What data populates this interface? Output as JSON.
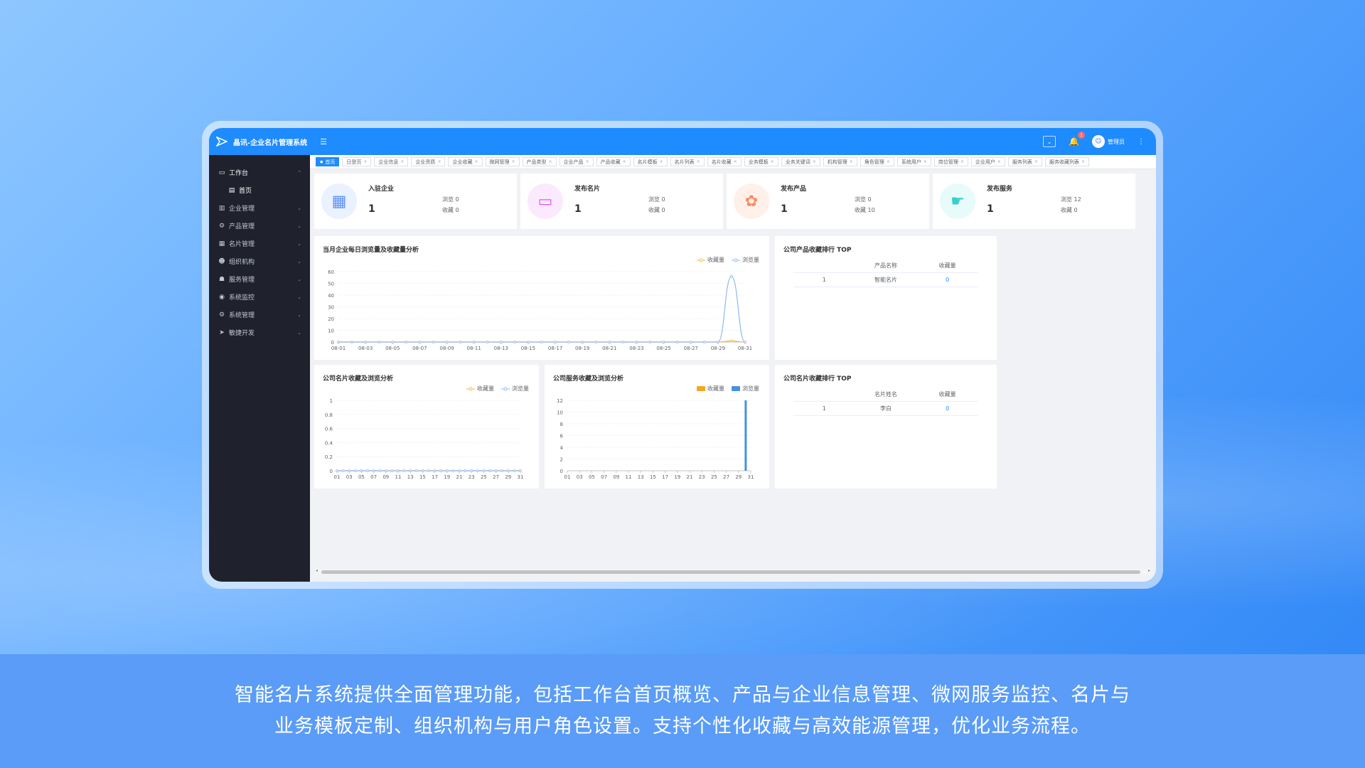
{
  "app": {
    "title": "晶讯-企业名片管理系统",
    "notification_count": "1",
    "user_name": "管理员"
  },
  "sidebar": {
    "items": [
      {
        "label": "工作台",
        "icon": "monitor-icon"
      },
      {
        "label": "首页",
        "icon": "document-icon"
      },
      {
        "label": "企业管理",
        "icon": "building-icon"
      },
      {
        "label": "产品管理",
        "icon": "gear-icon"
      },
      {
        "label": "名片管理",
        "icon": "card-icon"
      },
      {
        "label": "组织机构",
        "icon": "people-icon"
      },
      {
        "label": "服务管理",
        "icon": "service-icon"
      },
      {
        "label": "系统监控",
        "icon": "monitor-dial-icon"
      },
      {
        "label": "系统管理",
        "icon": "settings-icon"
      },
      {
        "label": "敏捷开发",
        "icon": "send-icon"
      }
    ]
  },
  "tabs": [
    "首页",
    "日登页",
    "企业信息",
    "企业资质",
    "企业收藏",
    "微网管理",
    "产品类型",
    "企业产品",
    "产品收藏",
    "名片模板",
    "名片列表",
    "名片收藏",
    "业务模板",
    "业务关键词",
    "机构管理",
    "角色管理",
    "系统用户",
    "岗位管理",
    "企业用户",
    "服务列表",
    "服务收藏列表"
  ],
  "stats": [
    {
      "title": "入驻企业",
      "value": "1",
      "browse_label": "浏览",
      "browse": "0",
      "fav_label": "收藏",
      "fav": "0",
      "color": "#5b8ff9",
      "bg": "#eaf1ff"
    },
    {
      "title": "发布名片",
      "value": "1",
      "browse_label": "浏览",
      "browse": "0",
      "fav_label": "收藏",
      "fav": "0",
      "color": "#e056fd",
      "bg": "#fbeafe"
    },
    {
      "title": "发布产品",
      "value": "1",
      "browse_label": "浏览",
      "browse": "0",
      "fav_label": "收藏",
      "fav": "10",
      "color": "#ff8a5c",
      "bg": "#fff0ea"
    },
    {
      "title": "发布服务",
      "value": "1",
      "browse_label": "浏览",
      "browse": "12",
      "fav_label": "收藏",
      "fav": "0",
      "color": "#36cfc9",
      "bg": "#e6fbfa"
    }
  ],
  "panels": {
    "daily": {
      "title": "当月企业每日浏览量及收藏量分析"
    },
    "product_top": {
      "title": "公司产品收藏排行 TOP",
      "col1": "产品名称",
      "col2": "收藏量",
      "rows": [
        {
          "rank": "1",
          "name": "智能名片",
          "count": "0"
        }
      ]
    },
    "card": {
      "title": "公司名片收藏及浏览分析"
    },
    "service": {
      "title": "公司服务收藏及浏览分析"
    },
    "card_top": {
      "title": "公司名片收藏排行 TOP",
      "col1": "名片姓名",
      "col2": "收藏量",
      "rows": [
        {
          "rank": "1",
          "name": "李白",
          "count": "0"
        }
      ]
    }
  },
  "legend": {
    "fav": "收藏量",
    "browse": "浏览量"
  },
  "caption": {
    "line1": "智能名片系统提供全面管理功能，包括工作台首页概览、产品与企业信息管理、微网服务监控、名片与",
    "line2": "业务模板定制、组织机构与用户角色设置。支持个性化收藏与高效能源管理，优化业务流程。"
  },
  "chart_data": [
    {
      "type": "line",
      "title": "当月企业每日浏览量及收藏量分析",
      "x": [
        "08-01",
        "08-02",
        "08-03",
        "08-04",
        "08-05",
        "08-06",
        "08-07",
        "08-08",
        "08-09",
        "08-10",
        "08-11",
        "08-12",
        "08-13",
        "08-14",
        "08-15",
        "08-16",
        "08-17",
        "08-18",
        "08-19",
        "08-20",
        "08-21",
        "08-22",
        "08-23",
        "08-24",
        "08-25",
        "08-26",
        "08-27",
        "08-28",
        "08-29",
        "08-30",
        "08-31"
      ],
      "x_ticks": [
        "08-01",
        "08-03",
        "08-05",
        "08-07",
        "08-09",
        "08-11",
        "08-13",
        "08-15",
        "08-17",
        "08-19",
        "08-21",
        "08-23",
        "08-25",
        "08-27",
        "08-29",
        "08-31"
      ],
      "ylim": [
        0,
        60
      ],
      "y_ticks": [
        0,
        10,
        20,
        30,
        40,
        50,
        60
      ],
      "series": [
        {
          "name": "收藏量",
          "color": "#f5b942",
          "values": [
            0,
            0,
            0,
            0,
            0,
            0,
            0,
            0,
            0,
            0,
            0,
            0,
            0,
            0,
            0,
            0,
            0,
            0,
            0,
            0,
            0,
            0,
            0,
            0,
            0,
            0,
            0,
            0,
            0,
            1,
            0
          ]
        },
        {
          "name": "浏览量",
          "color": "#8fb8ef",
          "values": [
            0,
            0,
            0,
            0,
            0,
            0,
            0,
            0,
            0,
            0,
            0,
            0,
            0,
            0,
            0,
            0,
            0,
            0,
            0,
            0,
            0,
            0,
            0,
            0,
            0,
            0,
            0,
            0,
            0,
            56,
            0
          ]
        }
      ]
    },
    {
      "type": "line",
      "title": "公司名片收藏及浏览分析",
      "x_ticks": [
        "01",
        "03",
        "05",
        "07",
        "09",
        "11",
        "13",
        "15",
        "17",
        "19",
        "21",
        "23",
        "25",
        "27",
        "29",
        "31"
      ],
      "ylim": [
        0,
        1
      ],
      "y_ticks": [
        0,
        0.2,
        0.4,
        0.6,
        0.8,
        1
      ],
      "series": [
        {
          "name": "收藏量",
          "color": "#f5b942",
          "values": [
            0,
            0,
            0,
            0,
            0,
            0,
            0,
            0,
            0,
            0,
            0,
            0,
            0,
            0,
            0,
            0,
            0,
            0,
            0,
            0,
            0,
            0,
            0,
            0,
            0,
            0,
            0,
            0,
            0,
            0,
            0
          ]
        },
        {
          "name": "浏览量",
          "color": "#8fb8ef",
          "values": [
            0,
            0,
            0,
            0,
            0,
            0,
            0,
            0,
            0,
            0,
            0,
            0,
            0,
            0,
            0,
            0,
            0,
            0,
            0,
            0,
            0,
            0,
            0,
            0,
            0,
            0,
            0,
            0,
            0,
            0,
            0
          ]
        }
      ]
    },
    {
      "type": "bar",
      "title": "公司服务收藏及浏览分析",
      "x_ticks": [
        "01",
        "03",
        "05",
        "07",
        "09",
        "11",
        "13",
        "15",
        "17",
        "19",
        "21",
        "23",
        "25",
        "27",
        "29",
        "31"
      ],
      "ylim": [
        0,
        12
      ],
      "y_ticks": [
        0,
        2,
        4,
        6,
        8,
        10,
        12
      ],
      "series": [
        {
          "name": "收藏量",
          "color": "#f5a623",
          "values": [
            0,
            0,
            0,
            0,
            0,
            0,
            0,
            0,
            0,
            0,
            0,
            0,
            0,
            0,
            0,
            0,
            0,
            0,
            0,
            0,
            0,
            0,
            0,
            0,
            0,
            0,
            0,
            0,
            0,
            0,
            0
          ]
        },
        {
          "name": "浏览量",
          "color": "#4a90e2",
          "values": [
            0,
            0,
            0,
            0,
            0,
            0,
            0,
            0,
            0,
            0,
            0,
            0,
            0,
            0,
            0,
            0,
            0,
            0,
            0,
            0,
            0,
            0,
            0,
            0,
            0,
            0,
            0,
            0,
            0,
            12,
            0
          ]
        }
      ]
    }
  ]
}
